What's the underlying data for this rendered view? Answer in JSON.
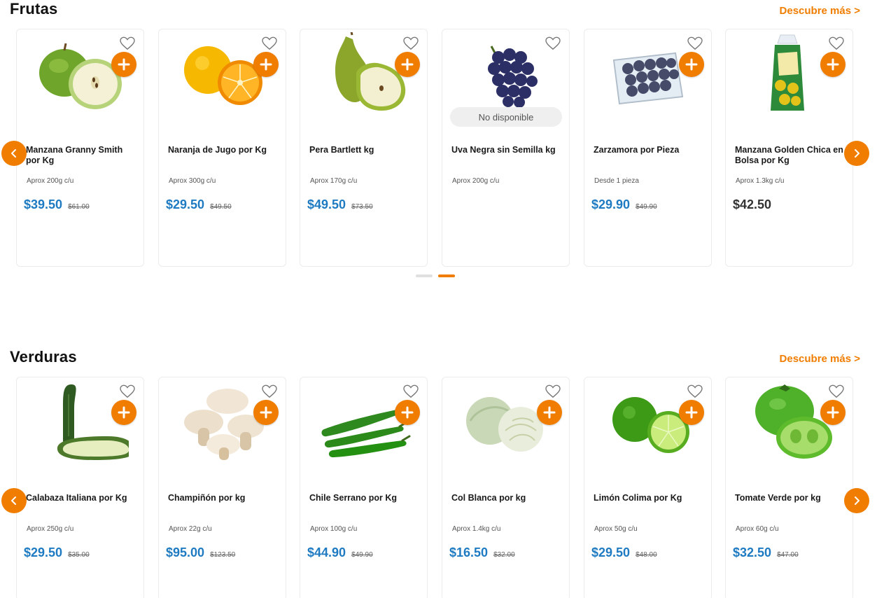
{
  "sections": [
    {
      "title": "Frutas",
      "discover": "Descubre más >",
      "products": [
        {
          "name": "Manzana Granny Smith por Kg",
          "approx": "Aprox 200g c/u",
          "price": "$39.50",
          "old_price": "$61.00",
          "icon": "green-apple"
        },
        {
          "name": "Naranja de Jugo por Kg",
          "approx": "Aprox 300g c/u",
          "price": "$29.50",
          "old_price": "$49.50",
          "icon": "orange"
        },
        {
          "name": "Pera Bartlett kg",
          "approx": "Aprox 170g c/u",
          "price": "$49.50",
          "old_price": "$73.50",
          "icon": "pear"
        },
        {
          "name": "Uva Negra sin Semilla kg",
          "approx": "Aprox 200g c/u",
          "price": "",
          "old_price": "",
          "badge": "No disponible",
          "icon": "black-grapes"
        },
        {
          "name": "Zarzamora por Pieza",
          "approx": "Desde 1 pieza",
          "price": "$29.90",
          "old_price": "$49.90",
          "icon": "blackberries"
        },
        {
          "name": "Manzana Golden Chica en Bolsa por Kg",
          "approx": "Aprox 1.3kg c/u",
          "price": "$42.50",
          "old_price": "",
          "icon": "apple-bag"
        }
      ]
    },
    {
      "title": "Verduras",
      "discover": "Descubre más >",
      "products": [
        {
          "name": "Calabaza Italiana por Kg",
          "approx": "Aprox 250g c/u",
          "price": "$29.50",
          "old_price": "$35.00",
          "icon": "zucchini"
        },
        {
          "name": "Champiñón por kg",
          "approx": "Aprox 22g c/u",
          "price": "$95.00",
          "old_price": "$123.50",
          "icon": "mushrooms"
        },
        {
          "name": "Chile Serrano por Kg",
          "approx": "Aprox 100g c/u",
          "price": "$44.90",
          "old_price": "$49.90",
          "icon": "chili"
        },
        {
          "name": "Col Blanca por kg",
          "approx": "Aprox 1.4kg c/u",
          "price": "$16.50",
          "old_price": "$32.00",
          "icon": "cabbage"
        },
        {
          "name": "Limón Colima por Kg",
          "approx": "Aprox 50g c/u",
          "price": "$29.50",
          "old_price": "$48.00",
          "icon": "lime"
        },
        {
          "name": "Tomate Verde por kg",
          "approx": "Aprox 60g c/u",
          "price": "$32.50",
          "old_price": "$47.00",
          "icon": "green-tomato"
        }
      ]
    }
  ],
  "colors": {
    "accent": "#f07d00",
    "price": "#1e7bc2",
    "price_plain": "#333333"
  }
}
